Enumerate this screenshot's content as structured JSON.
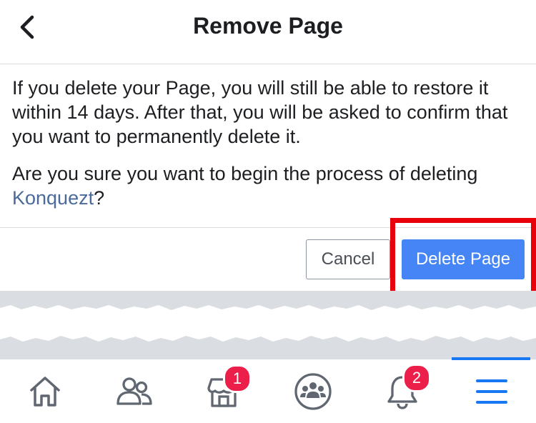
{
  "header": {
    "title": "Remove Page",
    "back_icon": "chevron-left-icon"
  },
  "dialog": {
    "body_text": "If you delete your Page, you will still be able to restore it within 14 days. After that, you will be asked to confirm that you want to permanently delete it.",
    "question_prefix": "Are you sure you want to begin the process of deleting ",
    "page_name": "Konquezt",
    "question_suffix": "?"
  },
  "actions": {
    "cancel_label": "Cancel",
    "delete_label": "Delete Page"
  },
  "annotation": {
    "color": "#e8000b"
  },
  "tabbar": {
    "tabs": [
      {
        "icon": "home-icon"
      },
      {
        "icon": "friends-icon"
      },
      {
        "icon": "marketplace-icon",
        "badge": "1"
      },
      {
        "icon": "groups-icon"
      },
      {
        "icon": "notifications-bell-icon",
        "badge": "2"
      },
      {
        "icon": "menu-icon",
        "active": true
      }
    ]
  },
  "colors": {
    "primary_button": "#4585f5",
    "link": "#4b6a9b",
    "badge": "#ec1e4a",
    "active_tab": "#1877f2"
  }
}
